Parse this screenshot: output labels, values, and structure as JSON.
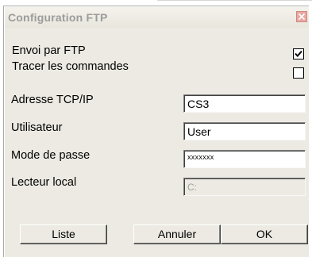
{
  "window": {
    "title": "Configuration FTP",
    "close_icon": "close-icon"
  },
  "options": {
    "send_ftp_label": "Envoi par FTP",
    "send_ftp_checked": true,
    "trace_label": "Tracer les commandes",
    "trace_checked": false
  },
  "fields": {
    "address_label": "Adresse TCP/IP",
    "address_value": "CS3",
    "user_label": "Utilisateur",
    "user_value": "User",
    "password_label": "Mode de passe",
    "password_value": "xxxxxxx",
    "local_drive_label": "Lecteur local",
    "local_drive_value": "C:"
  },
  "buttons": {
    "list_label": "Liste",
    "cancel_label": "Annuler",
    "ok_label": "OK"
  },
  "colors": {
    "dialog_bg": "#eceae2",
    "title_text": "#9c9c9c",
    "close_button": "#e7a9a2"
  }
}
